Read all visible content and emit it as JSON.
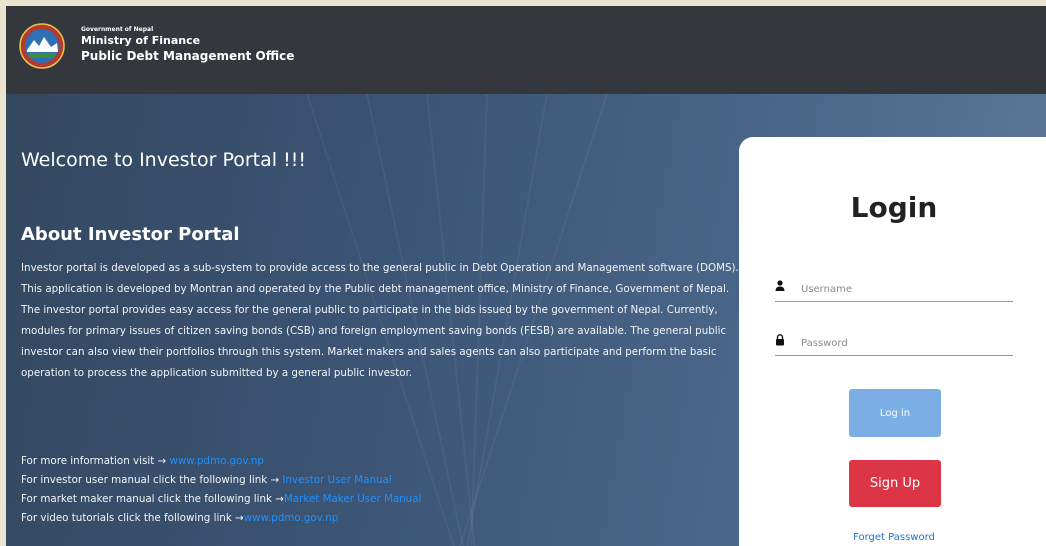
{
  "header": {
    "gov": "Government of Nepal",
    "ministry": "Ministry of Finance",
    "office": "Public Debt Management Office",
    "logo_icon": "nepal-emblem-icon"
  },
  "main": {
    "welcome": "Welcome to Investor Portal !!!",
    "about_title": "About Investor Portal",
    "about_text": "Investor portal is developed as a sub-system to provide access to the general public in Debt Operation and Management software (DOMS). This application is developed by Montran and operated by the Public debt management office, Ministry of Finance, Government of Nepal. The investor portal provides easy access for the general public to participate in the bids issued by the government of Nepal. Currently, modules for primary issues of citizen saving bonds (CSB) and foreign employment saving bonds (FESB) are available. The general public investor can also view their portfolios through this system. Market makers and sales agents can also participate and perform the basic operation to process the application submitted by a general public investor.",
    "links": [
      {
        "prefix": "For more information visit → ",
        "link": "www.pdmo.gov.np"
      },
      {
        "prefix": "For investor user manual click the following link → ",
        "link": "Investor User Manual"
      },
      {
        "prefix": "For market maker manual click the following link →",
        "link": "Market Maker User Manual"
      },
      {
        "prefix": "For video tutorials click the following link →",
        "link": "www.pdmo.gov.np"
      }
    ]
  },
  "login": {
    "title": "Login",
    "username_placeholder": "Username",
    "password_placeholder": "Password",
    "login_button": "Log in",
    "signup_button": "Sign Up",
    "forget_password": "Forget Password",
    "username_icon": "user-icon",
    "password_icon": "lock-icon"
  },
  "colors": {
    "header_bg": "#34383d",
    "login_button": "#7aaee4",
    "signup_button": "#dc3545",
    "link": "#1e90ff"
  }
}
